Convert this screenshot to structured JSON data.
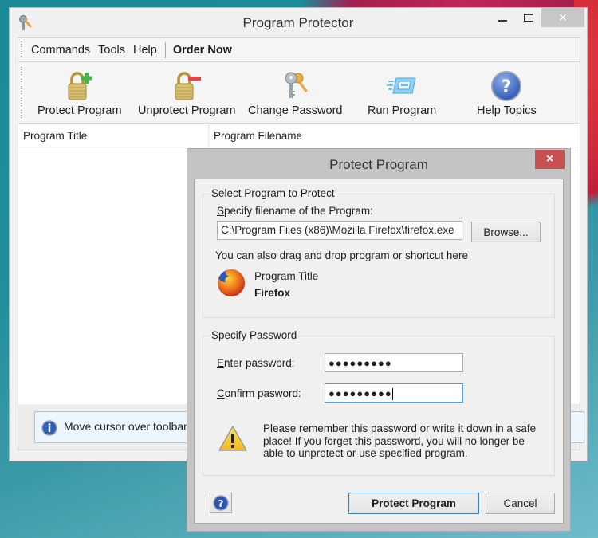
{
  "window": {
    "title": "Program Protector",
    "buttons": {
      "minimize": "minimize",
      "maximize": "maximize",
      "close": "×"
    }
  },
  "menu": {
    "items": [
      {
        "label": "Commands"
      },
      {
        "label": "Tools"
      },
      {
        "label": "Help"
      }
    ],
    "order_now": "Order Now"
  },
  "toolbar": {
    "buttons": [
      {
        "label": "Protect Program",
        "icon": "lock-add-icon"
      },
      {
        "label": "Unprotect Program",
        "icon": "lock-remove-icon"
      },
      {
        "label": "Change Password",
        "icon": "keys-icon"
      },
      {
        "label": "Run Program",
        "icon": "run-program-icon"
      },
      {
        "label": "Help Topics",
        "icon": "help-icon"
      }
    ]
  },
  "list": {
    "columns": [
      "Program Title",
      "Program Filename"
    ],
    "rows": []
  },
  "status": {
    "text": "Move cursor over toolbar but"
  },
  "dialog": {
    "title": "Protect Program",
    "close": "×",
    "select_group": {
      "label": "Select Program to Protect",
      "filename_label_first": "S",
      "filename_label_rest": "pecify filename of the Program:",
      "filename_value": "C:\\Program Files (x86)\\Mozilla Firefox\\firefox.exe",
      "browse_button": "Browse...",
      "drag_hint": "You can also drag and drop program or shortcut here",
      "program_title_label": "Program Title",
      "program_title_value": "Firefox"
    },
    "password_group": {
      "label": "Specify Password",
      "enter_label_first": "E",
      "enter_label_rest": "nter password:",
      "enter_value": "●●●●●●●●●",
      "confirm_label_first": "C",
      "confirm_label_rest": "onfirm pasword:",
      "confirm_value": "●●●●●●●●●",
      "warning_line1": "Please remember this password or write it down in a safe",
      "warning_line2": "place! If you forget this password, you will no longer be",
      "warning_line3": "able to unprotect or use specified program."
    },
    "buttons": {
      "protect": "Protect Program",
      "cancel": "Cancel"
    }
  },
  "colors": {
    "dialog_close": "#c75050",
    "focus_border": "#569de5",
    "status_bg": "#edf5fd"
  }
}
